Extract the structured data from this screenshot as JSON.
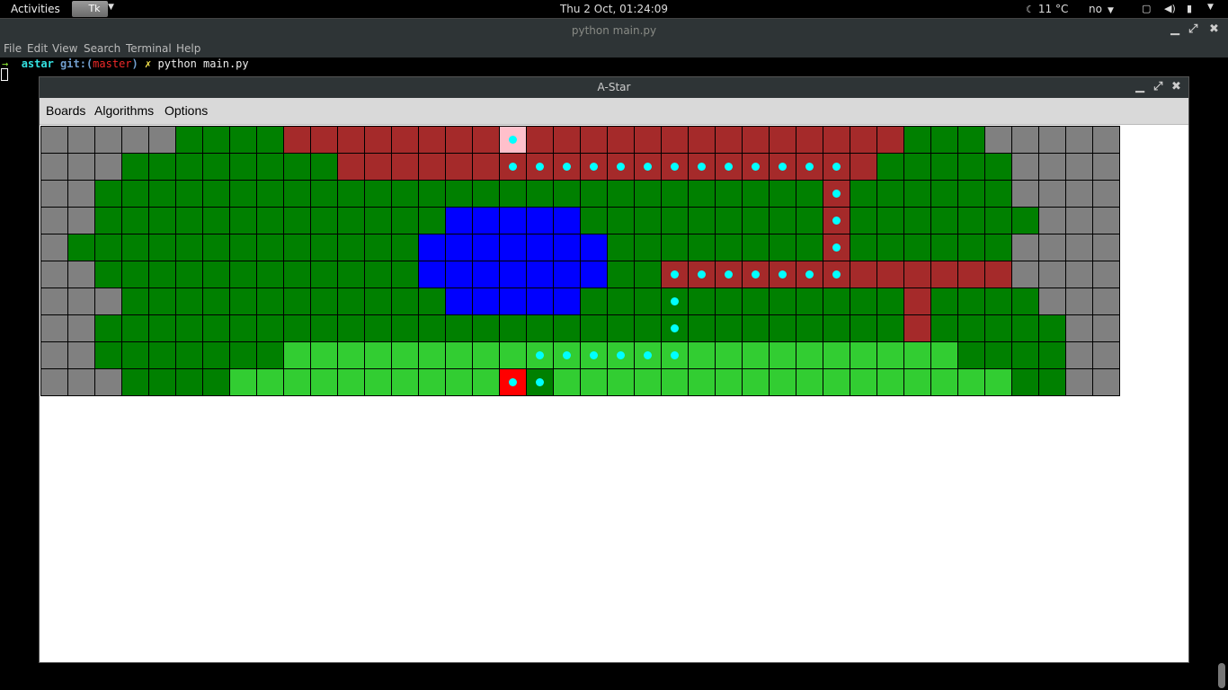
{
  "topbar": {
    "activities": "Activities",
    "app_label": "Tk",
    "clock": "Thu  2 Oct, 01:24:09",
    "weather": "11 °C",
    "language": "no"
  },
  "terminal": {
    "title": "python main.py",
    "menu": [
      "File",
      "Edit",
      "View",
      "Search",
      "Terminal",
      "Help"
    ],
    "prompt": {
      "arrow": "→",
      "dir": "astar",
      "git": "git:(",
      "branch": "master",
      "git_close": ")",
      "dirty": "✗",
      "command": "python main.py"
    }
  },
  "astar_window": {
    "title": "A-Star",
    "menu": [
      "Boards",
      "Algorithms",
      "Options"
    ]
  },
  "colors": {
    "G": "#808080",
    "D": "#008000",
    "L": "#32cd32",
    "B": "#0000ff",
    "R": "#a52a2a",
    "P": "#ffc0cb",
    "E": "#ff0000",
    "path_dot": "#00ffff"
  },
  "legend_codes": {
    "G": "gray",
    "D": "dark-green",
    "L": "light-green",
    "B": "blue",
    "R": "brown",
    "P": "start",
    "E": "goal"
  },
  "board": {
    "columns": 40,
    "rows": [
      "GGGGGDDDDRRRRRRRRPRRRRRRRRRRRRRRDDDGGGGG",
      "GGGDDDDDDDDRRRRRRRRRRRRRRRRRRRRDDDDDGGGG",
      "GGDDDDDDDDDDDDDDDDDDDDDDDDDDDRDDDDDDGGGG",
      "GGDDDDDDDDDDDDDBBBBBDDDDDDDDDRDDDDDDDGGG",
      "GDDDDDDDDDDDDDBBBBBBBDDDDDDDDRDDDDDDGGGG",
      "GGDDDDDDDDDDDDBBBBBBBDDRRRRRRRRRRRRRGGGG",
      "GGGDDDDDDDDDDDDBBBBBDDDDDDDDDDDDRDDDDGGG",
      "GGDDDDDDDDDDDDDDDDDDDDDDDDDDDDDDRDDDDDGG",
      "GGDDDDDDDLLLLLLLLLLLLLLLLLLLLLLLLLDDDDGG",
      "GGGDDDDLLLLLLLLLLEDLLLLLLLLLLLLLLLLLDDGG"
    ],
    "path": [
      [
        0,
        17
      ],
      [
        1,
        17
      ],
      [
        1,
        18
      ],
      [
        1,
        19
      ],
      [
        1,
        20
      ],
      [
        1,
        21
      ],
      [
        1,
        22
      ],
      [
        1,
        23
      ],
      [
        1,
        24
      ],
      [
        1,
        25
      ],
      [
        1,
        26
      ],
      [
        1,
        27
      ],
      [
        1,
        28
      ],
      [
        1,
        29
      ],
      [
        2,
        29
      ],
      [
        3,
        29
      ],
      [
        4,
        29
      ],
      [
        5,
        23
      ],
      [
        5,
        24
      ],
      [
        5,
        25
      ],
      [
        5,
        26
      ],
      [
        5,
        27
      ],
      [
        5,
        28
      ],
      [
        5,
        29
      ],
      [
        6,
        23
      ],
      [
        7,
        23
      ],
      [
        8,
        18
      ],
      [
        8,
        19
      ],
      [
        8,
        20
      ],
      [
        8,
        21
      ],
      [
        8,
        22
      ],
      [
        8,
        23
      ],
      [
        9,
        17
      ],
      [
        9,
        18
      ]
    ]
  }
}
